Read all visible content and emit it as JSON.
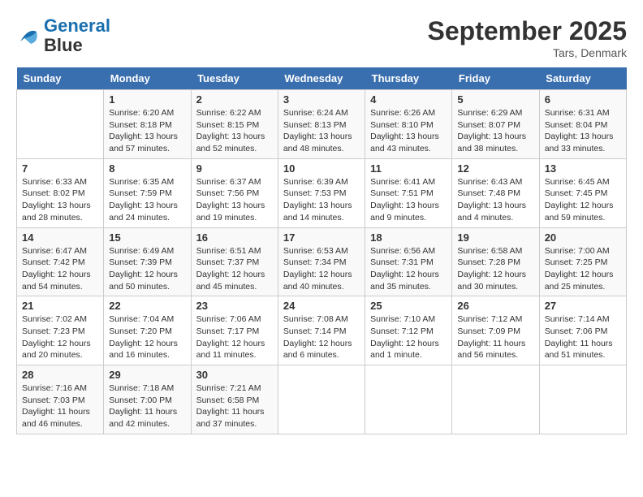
{
  "header": {
    "logo_line1": "General",
    "logo_line2": "Blue",
    "month": "September 2025",
    "location": "Tars, Denmark"
  },
  "days_of_week": [
    "Sunday",
    "Monday",
    "Tuesday",
    "Wednesday",
    "Thursday",
    "Friday",
    "Saturday"
  ],
  "weeks": [
    [
      {
        "day": "",
        "info": ""
      },
      {
        "day": "1",
        "info": "Sunrise: 6:20 AM\nSunset: 8:18 PM\nDaylight: 13 hours\nand 57 minutes."
      },
      {
        "day": "2",
        "info": "Sunrise: 6:22 AM\nSunset: 8:15 PM\nDaylight: 13 hours\nand 52 minutes."
      },
      {
        "day": "3",
        "info": "Sunrise: 6:24 AM\nSunset: 8:13 PM\nDaylight: 13 hours\nand 48 minutes."
      },
      {
        "day": "4",
        "info": "Sunrise: 6:26 AM\nSunset: 8:10 PM\nDaylight: 13 hours\nand 43 minutes."
      },
      {
        "day": "5",
        "info": "Sunrise: 6:29 AM\nSunset: 8:07 PM\nDaylight: 13 hours\nand 38 minutes."
      },
      {
        "day": "6",
        "info": "Sunrise: 6:31 AM\nSunset: 8:04 PM\nDaylight: 13 hours\nand 33 minutes."
      }
    ],
    [
      {
        "day": "7",
        "info": "Sunrise: 6:33 AM\nSunset: 8:02 PM\nDaylight: 13 hours\nand 28 minutes."
      },
      {
        "day": "8",
        "info": "Sunrise: 6:35 AM\nSunset: 7:59 PM\nDaylight: 13 hours\nand 24 minutes."
      },
      {
        "day": "9",
        "info": "Sunrise: 6:37 AM\nSunset: 7:56 PM\nDaylight: 13 hours\nand 19 minutes."
      },
      {
        "day": "10",
        "info": "Sunrise: 6:39 AM\nSunset: 7:53 PM\nDaylight: 13 hours\nand 14 minutes."
      },
      {
        "day": "11",
        "info": "Sunrise: 6:41 AM\nSunset: 7:51 PM\nDaylight: 13 hours\nand 9 minutes."
      },
      {
        "day": "12",
        "info": "Sunrise: 6:43 AM\nSunset: 7:48 PM\nDaylight: 13 hours\nand 4 minutes."
      },
      {
        "day": "13",
        "info": "Sunrise: 6:45 AM\nSunset: 7:45 PM\nDaylight: 12 hours\nand 59 minutes."
      }
    ],
    [
      {
        "day": "14",
        "info": "Sunrise: 6:47 AM\nSunset: 7:42 PM\nDaylight: 12 hours\nand 54 minutes."
      },
      {
        "day": "15",
        "info": "Sunrise: 6:49 AM\nSunset: 7:39 PM\nDaylight: 12 hours\nand 50 minutes."
      },
      {
        "day": "16",
        "info": "Sunrise: 6:51 AM\nSunset: 7:37 PM\nDaylight: 12 hours\nand 45 minutes."
      },
      {
        "day": "17",
        "info": "Sunrise: 6:53 AM\nSunset: 7:34 PM\nDaylight: 12 hours\nand 40 minutes."
      },
      {
        "day": "18",
        "info": "Sunrise: 6:56 AM\nSunset: 7:31 PM\nDaylight: 12 hours\nand 35 minutes."
      },
      {
        "day": "19",
        "info": "Sunrise: 6:58 AM\nSunset: 7:28 PM\nDaylight: 12 hours\nand 30 minutes."
      },
      {
        "day": "20",
        "info": "Sunrise: 7:00 AM\nSunset: 7:25 PM\nDaylight: 12 hours\nand 25 minutes."
      }
    ],
    [
      {
        "day": "21",
        "info": "Sunrise: 7:02 AM\nSunset: 7:23 PM\nDaylight: 12 hours\nand 20 minutes."
      },
      {
        "day": "22",
        "info": "Sunrise: 7:04 AM\nSunset: 7:20 PM\nDaylight: 12 hours\nand 16 minutes."
      },
      {
        "day": "23",
        "info": "Sunrise: 7:06 AM\nSunset: 7:17 PM\nDaylight: 12 hours\nand 11 minutes."
      },
      {
        "day": "24",
        "info": "Sunrise: 7:08 AM\nSunset: 7:14 PM\nDaylight: 12 hours\nand 6 minutes."
      },
      {
        "day": "25",
        "info": "Sunrise: 7:10 AM\nSunset: 7:12 PM\nDaylight: 12 hours\nand 1 minute."
      },
      {
        "day": "26",
        "info": "Sunrise: 7:12 AM\nSunset: 7:09 PM\nDaylight: 11 hours\nand 56 minutes."
      },
      {
        "day": "27",
        "info": "Sunrise: 7:14 AM\nSunset: 7:06 PM\nDaylight: 11 hours\nand 51 minutes."
      }
    ],
    [
      {
        "day": "28",
        "info": "Sunrise: 7:16 AM\nSunset: 7:03 PM\nDaylight: 11 hours\nand 46 minutes."
      },
      {
        "day": "29",
        "info": "Sunrise: 7:18 AM\nSunset: 7:00 PM\nDaylight: 11 hours\nand 42 minutes."
      },
      {
        "day": "30",
        "info": "Sunrise: 7:21 AM\nSunset: 6:58 PM\nDaylight: 11 hours\nand 37 minutes."
      },
      {
        "day": "",
        "info": ""
      },
      {
        "day": "",
        "info": ""
      },
      {
        "day": "",
        "info": ""
      },
      {
        "day": "",
        "info": ""
      }
    ]
  ]
}
